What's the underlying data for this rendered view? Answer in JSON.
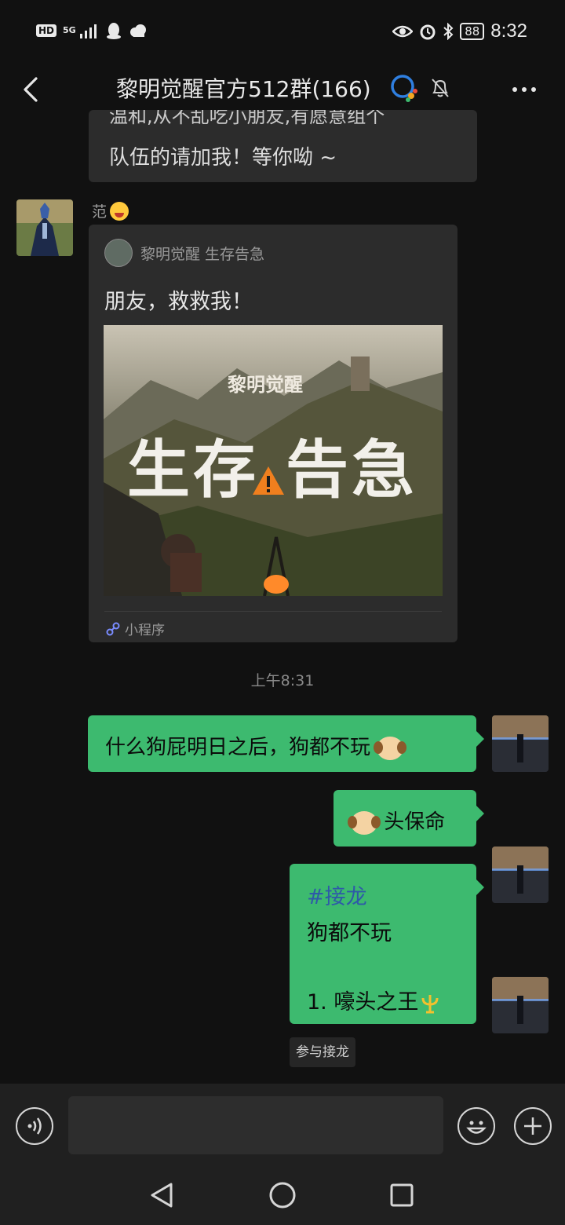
{
  "status_bar": {
    "left_hd": "HD",
    "left_net": "5G",
    "battery": "88",
    "time": "8:32"
  },
  "header": {
    "title": "黎明觉醒官方512群(166)"
  },
  "messages": {
    "top_partial_line1": "温和,从不乱吃小朋友,有愿意组个",
    "top_partial_line2": "队伍的请加我！等你呦 ~",
    "sender_name": "范",
    "mini_program": {
      "app_name": "黎明觉醒 生存告急",
      "message": "朋友，救救我！",
      "footer_label": "小程序",
      "image_brand": "黎明觉醒",
      "image_title_left": "生存",
      "image_title_right": "告急"
    },
    "timestamp": "上午8:31",
    "msg1": "什么狗屁明日之后，狗都不玩",
    "msg2": "头保命",
    "msg3": {
      "hashtag": "#接龙",
      "line2": "狗都不玩",
      "line3": "1. 嚎头之王"
    },
    "join_button": "参与接龙"
  },
  "input": {
    "placeholder": ""
  },
  "colors": {
    "background": "#111111",
    "bubble_gray": "#2c2c2c",
    "bubble_green": "#3dba6f",
    "hashtag_blue": "#2e5aa8"
  }
}
